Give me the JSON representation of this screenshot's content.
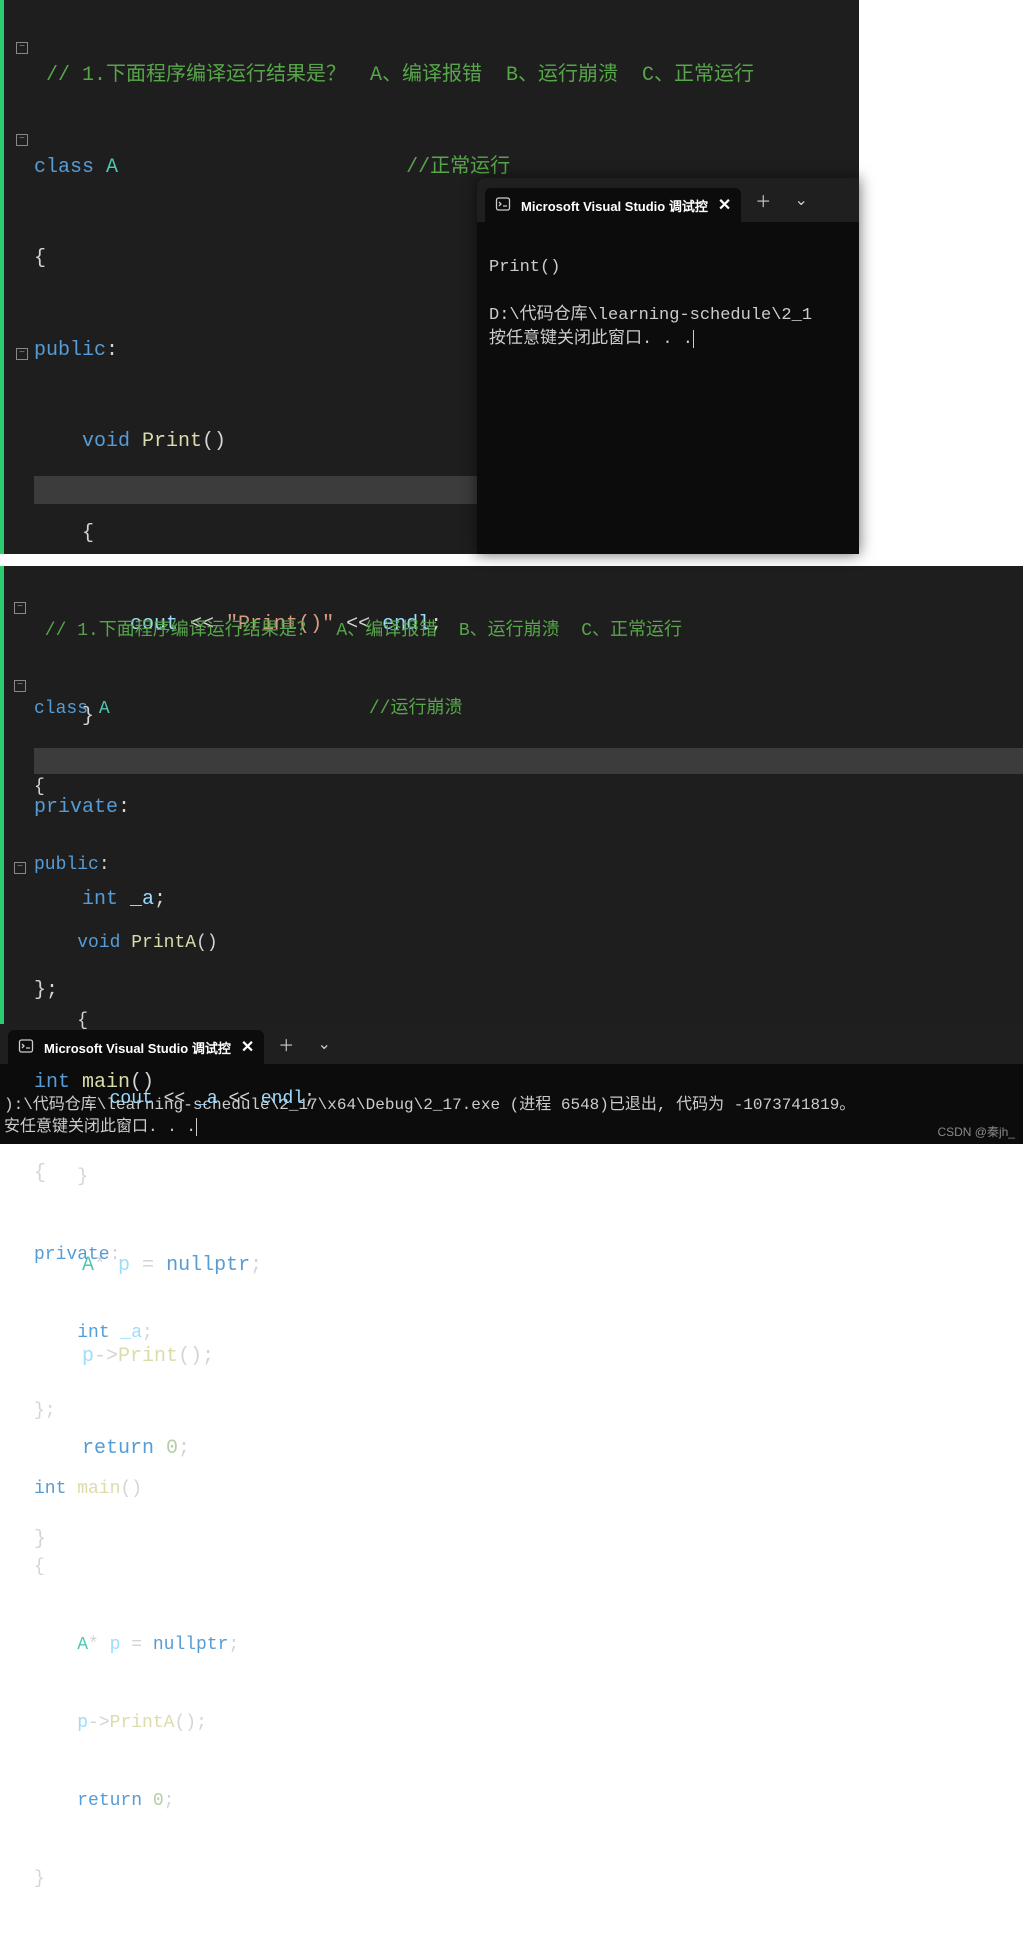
{
  "editor1": {
    "comment_question": " // 1.下面程序编译运行结果是？  A、编译报错  B、运行崩溃  C、正常运行",
    "comment_answer": "//正常运行",
    "kw_class": "class",
    "class_name": " A",
    "brace_open": "{",
    "kw_public": "public",
    "colon": ":",
    "kw_void": "void",
    "fn_print": " Print",
    "parens": "()",
    "cout_line_1": "        cout ",
    "op_shift": "<<",
    "str_print": " \"Print()\" ",
    "endl": " endl",
    "semi": ";",
    "brace_close_inner": "    }",
    "kw_private": "private",
    "kw_int": "int",
    "var_a": " _a",
    "brace_close_class": "};",
    "fn_main": " main",
    "ptr_line_A": "    A",
    "star": "*",
    "var_p": " p ",
    "eq": "=",
    "nullptr": " nullptr",
    "arrow": "->",
    "call_print": "Print",
    "kw_return": "return",
    "zero": " 0",
    "brace_close_main": "}"
  },
  "console1": {
    "tab_title": "Microsoft Visual Studio 调试控",
    "line1": "Print()",
    "line2": "D:\\代码仓库\\learning-schedule\\2_1",
    "line3": "按任意键关闭此窗口. . ."
  },
  "editor2": {
    "comment_question": " // 1.下面程序编译运行结果是？  A、编译报错  B、运行崩溃  C、正常运行",
    "comment_answer": "//运行崩溃",
    "kw_class": "class",
    "class_name": " A",
    "kw_public": "public",
    "kw_void": "void",
    "fn_printa": " PrintA",
    "parens": "()",
    "cout_prefix": "       cout ",
    "op_shift": "<<",
    "var_a_ref": " _a ",
    "endl": " endl",
    "semi": ";",
    "kw_private": "private",
    "kw_int": "int",
    "var_a": " _a",
    "brace_close_class": "};",
    "fn_main": " main",
    "ptr_line_A": "    A",
    "star": "*",
    "var_p": " p ",
    "eq": "=",
    "nullptr": " nullptr",
    "arrow": "->",
    "call_printa": "PrintA",
    "kw_return": "return",
    "zero": " 0",
    "brace_close_main": "}"
  },
  "console2": {
    "tab_title": "Microsoft Visual Studio 调试控",
    "line1": "):\\代码仓库\\learning-schedule\\2_17\\x64\\Debug\\2_17.exe (进程 6548)已退出, 代码为 -1073741819。",
    "line2": "安任意键关闭此窗口. . ."
  },
  "watermark": "CSDN @秦jh_"
}
